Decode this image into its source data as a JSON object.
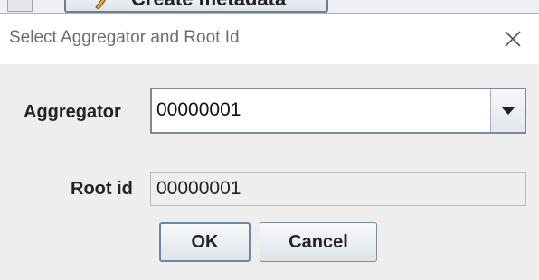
{
  "background": {
    "button_label": "Create metadata"
  },
  "dialog": {
    "title": "Select Aggregator and Root Id",
    "close_icon": "close-icon",
    "aggregator": {
      "label": "Aggregator",
      "value": "00000001",
      "dropdown_icon": "triangle-down-icon"
    },
    "root_id": {
      "label": "Root id",
      "value": "00000001"
    },
    "buttons": {
      "ok": "OK",
      "cancel": "Cancel"
    }
  }
}
